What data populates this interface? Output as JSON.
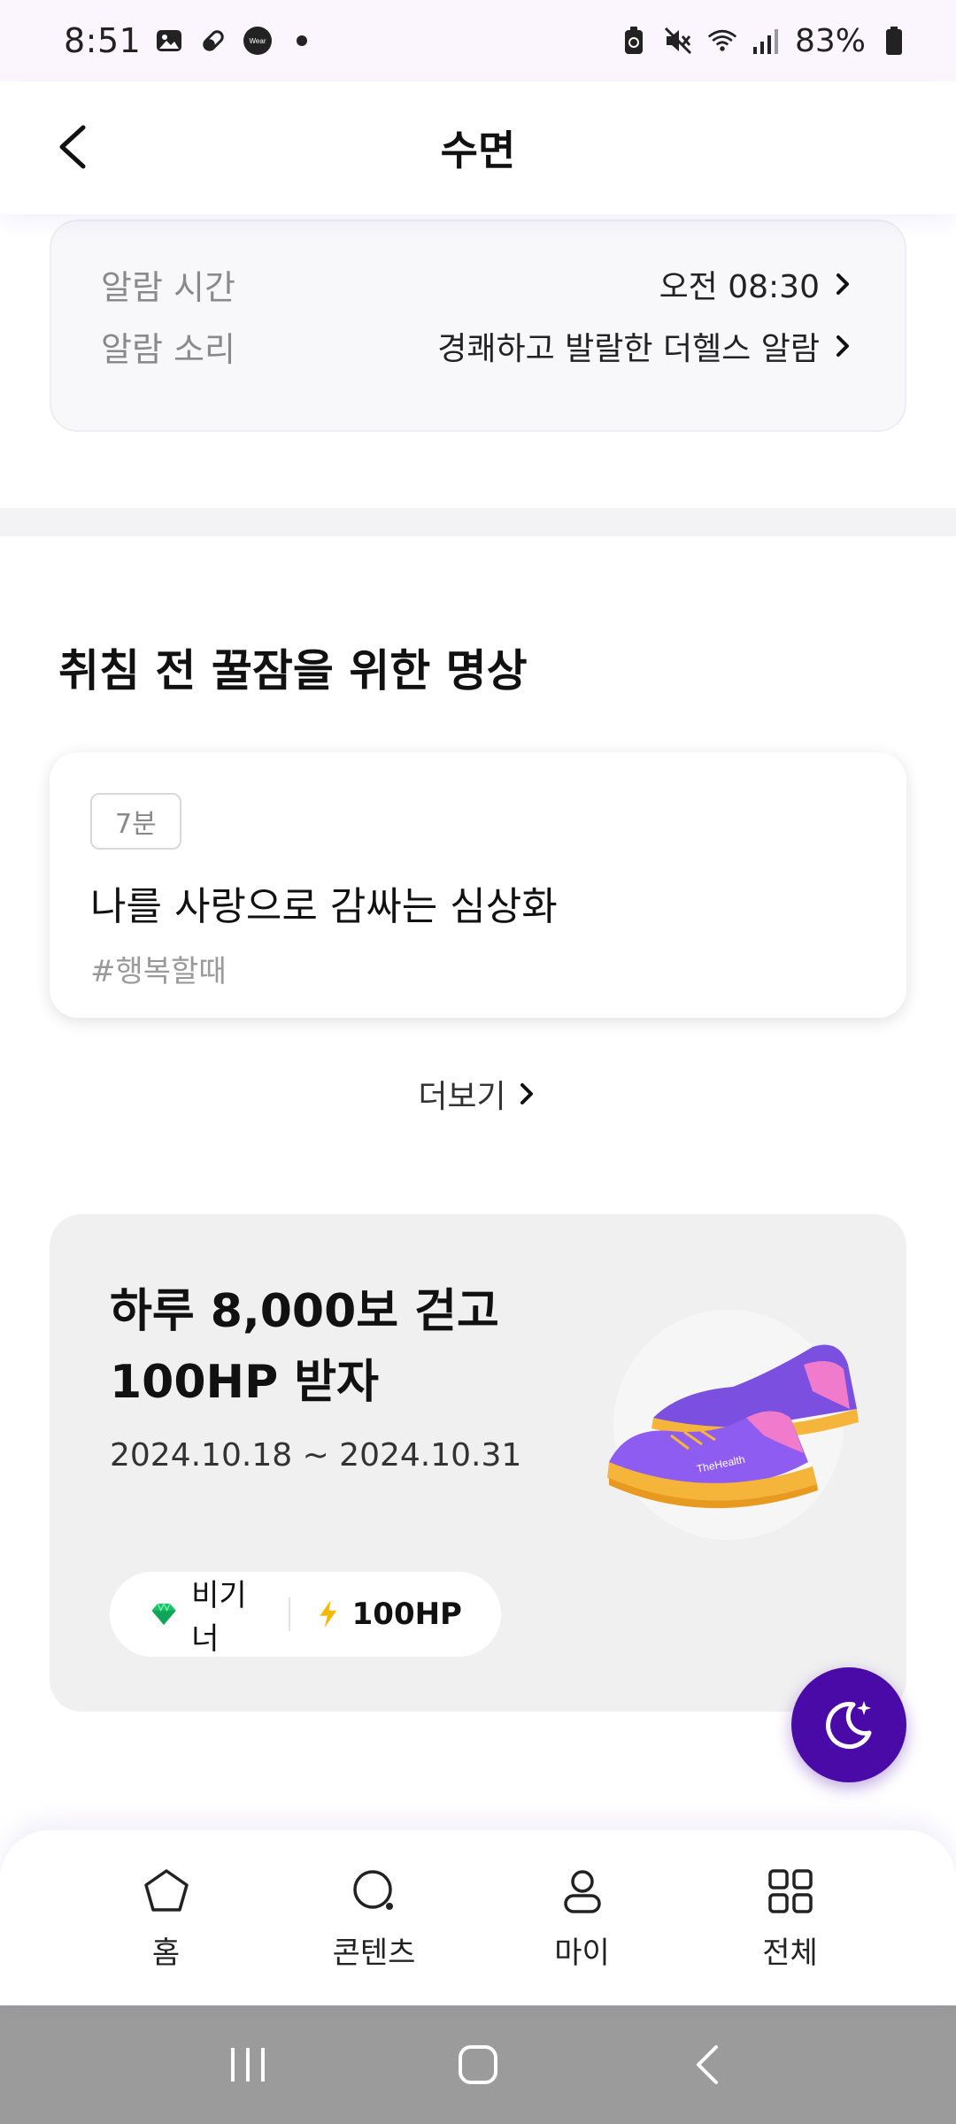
{
  "status_bar": {
    "time": "8:51",
    "wear_label": "Wear",
    "battery_percent": "83%"
  },
  "header": {
    "title": "수면"
  },
  "alarm": {
    "rows": [
      {
        "label": "알람 시간",
        "value": "오전 08:30"
      },
      {
        "label": "알람 소리",
        "value": "경쾌하고 발랄한 더헬스 알람"
      }
    ]
  },
  "meditation": {
    "section_title": "취침 전 꿀잠을 위한 명상",
    "card": {
      "duration": "7분",
      "title": "나를 사랑으로 감싸는 심상화",
      "tag": "#행복할때"
    },
    "more_label": "더보기"
  },
  "promo": {
    "title_line1": "하루 8,000보 걷고",
    "title_line2": "100HP 받자",
    "date_range": "2024.10.18 ~ 2024.10.31",
    "level_label": "비기너",
    "reward_label": "100HP",
    "shoe_brand": "TheHealth"
  },
  "bottom_nav": {
    "items": [
      {
        "label": "홈",
        "icon": "home-pentagon-icon"
      },
      {
        "label": "콘텐츠",
        "icon": "contents-search-icon"
      },
      {
        "label": "마이",
        "icon": "person-icon"
      },
      {
        "label": "전체",
        "icon": "grid-icon"
      }
    ]
  },
  "colors": {
    "accent_purple": "#4a0aa8",
    "status_bar_bg": "#fbf6fd",
    "card_bg": "#f0f0f0",
    "system_nav_bg": "#9b9b9b"
  }
}
